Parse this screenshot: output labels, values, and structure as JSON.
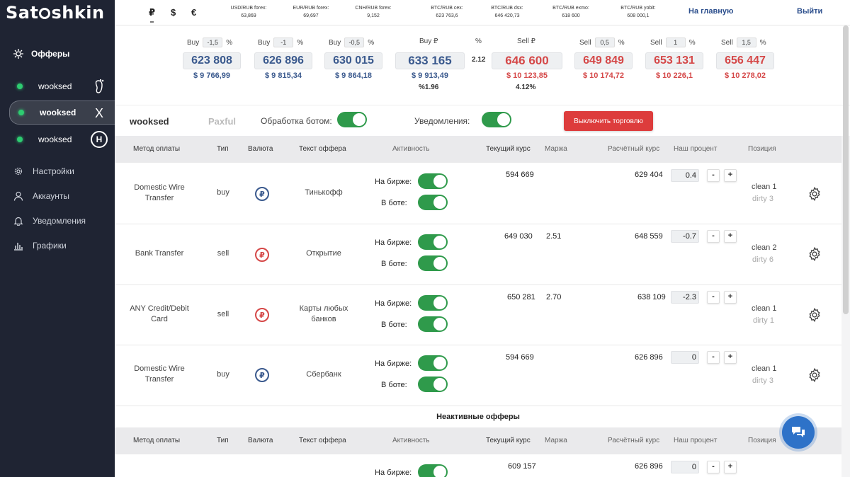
{
  "app": {
    "logo_left": "Sat",
    "logo_right": "shkin"
  },
  "sidebar": {
    "title": "Офферы",
    "accounts": [
      {
        "name": "wooksed",
        "exchange_icon": "foot-icon"
      },
      {
        "name": "wooksed",
        "exchange_icon": "x-icon",
        "active": true
      },
      {
        "name": "wooksed",
        "exchange_icon": "h-circle-icon"
      }
    ],
    "menu": [
      {
        "label": "Настройки",
        "icon": "gear-icon"
      },
      {
        "label": "Аккаунты",
        "icon": "user-icon"
      },
      {
        "label": "Уведомления",
        "icon": "bell-icon"
      },
      {
        "label": "Графики",
        "icon": "chart-icon"
      }
    ]
  },
  "topbar": {
    "currencies": [
      "₽",
      "$",
      "€"
    ],
    "rates": [
      {
        "label": "USD/RUB forex:",
        "value": "63,869"
      },
      {
        "label": "EUR/RUB forex:",
        "value": "69,697"
      },
      {
        "label": "CNH/RUB forex:",
        "value": "9,152"
      },
      {
        "label": "BTC/RUB cex:",
        "value": "623 763,6"
      },
      {
        "label": "BTC/RUB dsx:",
        "value": "646 420,73"
      },
      {
        "label": "BTC/RUB exmo:",
        "value": "618 600"
      },
      {
        "label": "BTC/RUB yobit:",
        "value": "608 000,1"
      }
    ],
    "home_link": "На главную",
    "logout_link": "Выйти"
  },
  "prices": {
    "buy": [
      {
        "label": "Buy",
        "pct": "-1,5",
        "value": "623 808",
        "usd": "$ 9 766,99"
      },
      {
        "label": "Buy",
        "pct": "-1",
        "value": "626 896",
        "usd": "$ 9 815,34"
      },
      {
        "label": "Buy",
        "pct": "-0,5",
        "value": "630 015",
        "usd": "$ 9 864,18"
      }
    ],
    "buy_main": {
      "label": "Buy ₽",
      "value": "633 165",
      "usd": "$ 9 913,49",
      "sub": "%1.96"
    },
    "pct_sign": "%",
    "spread": "2.12",
    "sell_main": {
      "label": "Sell ₽",
      "value": "646 600",
      "usd": "$ 10 123,85",
      "sub": "4.12%"
    },
    "sell": [
      {
        "label": "Sell",
        "pct": "0,5",
        "value": "649 849",
        "usd": "$ 10 174,72"
      },
      {
        "label": "Sell",
        "pct": "1",
        "value": "653 131",
        "usd": "$ 10 226,1"
      },
      {
        "label": "Sell",
        "pct": "1,5",
        "value": "656 447",
        "usd": "$ 10 278,02"
      }
    ]
  },
  "controls": {
    "account": "wooksed",
    "exchange": "Paxful",
    "bot_label": "Обработка ботом:",
    "notify_label": "Уведомления:",
    "stop_button": "Выключить торговлю"
  },
  "table": {
    "headers": {
      "method": "Метод оплаты",
      "type": "Тип",
      "currency": "Валюта",
      "text": "Текст оффера",
      "activity": "Активность",
      "rate": "Текущий курс",
      "margin": "Маржа",
      "calc": "Расчётный курс",
      "percent": "Наш процент",
      "position": "Позиция"
    },
    "on_exchange": "На бирже:",
    "in_bot": "В боте:",
    "rows": [
      {
        "method": "Domestic Wire Transfer",
        "type": "buy",
        "coin": "blue",
        "text": "Тинькофф",
        "rate": "594 669",
        "margin": "",
        "calc": "629 404",
        "percent": "0.4",
        "pos1": "clean 1",
        "pos2": "dirty 3"
      },
      {
        "method": "Bank Transfer",
        "type": "sell",
        "coin": "red",
        "text": "Открытие",
        "rate": "649 030",
        "margin": "2.51",
        "calc": "648 559",
        "percent": "-0.7",
        "pos1": "clean 2",
        "pos2": "dirty 6"
      },
      {
        "method": "ANY Credit/Debit Card",
        "type": "sell",
        "coin": "red",
        "text": "Карты любых банков",
        "rate": "650 281",
        "margin": "2.70",
        "calc": "638 109",
        "percent": "-2.3",
        "pos1": "clean 1",
        "pos2": "dirty 1"
      },
      {
        "method": "Domestic Wire Transfer",
        "type": "buy",
        "coin": "blue",
        "text": "Сбербанк",
        "rate": "594 669",
        "margin": "",
        "calc": "626 896",
        "percent": "0",
        "pos1": "clean 1",
        "pos2": "dirty 3"
      }
    ],
    "inactive_title": "Неактивные офферы",
    "inactive_rows": [
      {
        "rate": "609 157",
        "calc": "626 896",
        "percent": "0"
      }
    ],
    "minus": "-",
    "plus": "+",
    "coin_symbol": "₽"
  }
}
